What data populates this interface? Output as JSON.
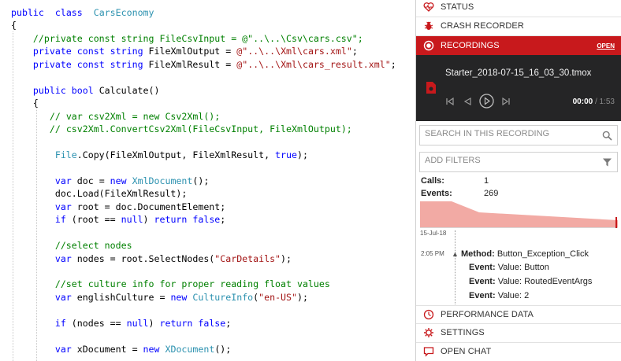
{
  "editor": {
    "lines": [
      [
        [
          "kw",
          "public"
        ],
        [
          "",
          "  "
        ],
        [
          "kw",
          "class"
        ],
        [
          "",
          "  "
        ],
        [
          "ty",
          "CarsEconomy"
        ]
      ],
      [
        [
          "",
          "{"
        ]
      ],
      [
        [
          "",
          "    "
        ],
        [
          "cm",
          "//private const string FileCsvInput = @\"..\\..\\Csv\\cars.csv\";"
        ]
      ],
      [
        [
          "",
          "    "
        ],
        [
          "kw",
          "private"
        ],
        [
          "",
          " "
        ],
        [
          "kw",
          "const"
        ],
        [
          "",
          " "
        ],
        [
          "kw",
          "string"
        ],
        [
          "",
          " FileXmlOutput = "
        ],
        [
          "str",
          "@\"..\\..\\Xml\\cars.xml\""
        ],
        [
          "",
          ";"
        ]
      ],
      [
        [
          "",
          "    "
        ],
        [
          "kw",
          "private"
        ],
        [
          "",
          " "
        ],
        [
          "kw",
          "const"
        ],
        [
          "",
          " "
        ],
        [
          "kw",
          "string"
        ],
        [
          "",
          " FileXmlResult = "
        ],
        [
          "str",
          "@\"..\\..\\Xml\\cars_result.xml\""
        ],
        [
          "",
          ";"
        ]
      ],
      [
        [
          "",
          ""
        ]
      ],
      [
        [
          "",
          "    "
        ],
        [
          "kw",
          "public"
        ],
        [
          "",
          " "
        ],
        [
          "kw",
          "bool"
        ],
        [
          "",
          " Calculate()"
        ]
      ],
      [
        [
          "",
          "    {"
        ]
      ],
      [
        [
          "",
          "       "
        ],
        [
          "cm",
          "// var csv2Xml = new Csv2Xml();"
        ]
      ],
      [
        [
          "",
          "       "
        ],
        [
          "cm",
          "// csv2Xml.ConvertCsv2Xml(FileCsvInput, FileXmlOutput);"
        ]
      ],
      [
        [
          "",
          ""
        ]
      ],
      [
        [
          "",
          "        "
        ],
        [
          "ty",
          "File"
        ],
        [
          "",
          ".Copy(FileXmlOutput, FileXmlResult, "
        ],
        [
          "kw",
          "true"
        ],
        [
          "",
          ");"
        ]
      ],
      [
        [
          "",
          ""
        ]
      ],
      [
        [
          "",
          "        "
        ],
        [
          "kw",
          "var"
        ],
        [
          "",
          " doc = "
        ],
        [
          "kw",
          "new"
        ],
        [
          "",
          " "
        ],
        [
          "ty",
          "XmlDocument"
        ],
        [
          "",
          "();"
        ]
      ],
      [
        [
          "",
          "        doc.Load(FileXmlResult);"
        ]
      ],
      [
        [
          "",
          "        "
        ],
        [
          "kw",
          "var"
        ],
        [
          "",
          " root = doc.DocumentElement;"
        ]
      ],
      [
        [
          "",
          "        "
        ],
        [
          "kw",
          "if"
        ],
        [
          "",
          " (root == "
        ],
        [
          "kw",
          "null"
        ],
        [
          "",
          ") "
        ],
        [
          "kw",
          "return"
        ],
        [
          "",
          " "
        ],
        [
          "kw",
          "false"
        ],
        [
          "",
          ";"
        ]
      ],
      [
        [
          "",
          ""
        ]
      ],
      [
        [
          "",
          "        "
        ],
        [
          "cm",
          "//select nodes"
        ]
      ],
      [
        [
          "",
          "        "
        ],
        [
          "kw",
          "var"
        ],
        [
          "",
          " nodes = root.SelectNodes("
        ],
        [
          "str",
          "\"CarDetails\""
        ],
        [
          "",
          ");"
        ]
      ],
      [
        [
          "",
          ""
        ]
      ],
      [
        [
          "",
          "        "
        ],
        [
          "cm",
          "//set culture info for proper reading float values"
        ]
      ],
      [
        [
          "",
          "        "
        ],
        [
          "kw",
          "var"
        ],
        [
          "",
          " englishCulture = "
        ],
        [
          "kw",
          "new"
        ],
        [
          "",
          " "
        ],
        [
          "ty",
          "CultureInfo"
        ],
        [
          "",
          "("
        ],
        [
          "str",
          "\"en-US\""
        ],
        [
          "",
          ");"
        ]
      ],
      [
        [
          "",
          ""
        ]
      ],
      [
        [
          "",
          "        "
        ],
        [
          "kw",
          "if"
        ],
        [
          "",
          " (nodes == "
        ],
        [
          "kw",
          "null"
        ],
        [
          "",
          ") "
        ],
        [
          "kw",
          "return"
        ],
        [
          "",
          " "
        ],
        [
          "kw",
          "false"
        ],
        [
          "",
          ";"
        ]
      ],
      [
        [
          "",
          ""
        ]
      ],
      [
        [
          "",
          "        "
        ],
        [
          "kw",
          "var"
        ],
        [
          "",
          " xDocument = "
        ],
        [
          "kw",
          "new"
        ],
        [
          "",
          " "
        ],
        [
          "ty",
          "XDocument"
        ],
        [
          "",
          "();"
        ]
      ]
    ]
  },
  "panel": {
    "status_label": "STATUS",
    "crash_recorder_label": "CRASH RECORDER",
    "recordings_label": "RECORDINGS",
    "open_label": "OPEN",
    "file_name": "Starter_2018-07-15_16_03_30.tmox",
    "time_current": "00:00",
    "time_separator": "/",
    "time_total": "1:53",
    "search_placeholder": "SEARCH IN THIS RECORDING",
    "filters_placeholder": "ADD FILTERS",
    "calls_label": "Calls:",
    "calls_value": "1",
    "events_label": "Events:",
    "events_value": "269",
    "timeline_date": "15-Jul-18",
    "timeline_time": "2:05 PM",
    "event": {
      "method_label": "Method:",
      "method_value": "Button_Exception_Click",
      "rows": [
        {
          "label": "Event:",
          "value": "Value: Button"
        },
        {
          "label": "Event:",
          "value": "Value: RoutedEventArgs"
        },
        {
          "label": "Event:",
          "value": "Value: 2"
        }
      ]
    },
    "performance_label": "PERFORMANCE DATA",
    "settings_label": "SETTINGS",
    "open_chat_label": "OPEN CHAT",
    "colors": {
      "accent_red": "#c8191c",
      "player_bg": "#252526",
      "chart_fill": "#f2aaa4"
    }
  },
  "icons": [
    "heart-pulse-icon",
    "bug-icon",
    "record-icon",
    "file-icon",
    "skip-back-icon",
    "prev-icon",
    "play-icon",
    "skip-forward-icon",
    "search-icon",
    "filter-icon",
    "gauge-icon",
    "gear-icon",
    "chat-icon"
  ]
}
